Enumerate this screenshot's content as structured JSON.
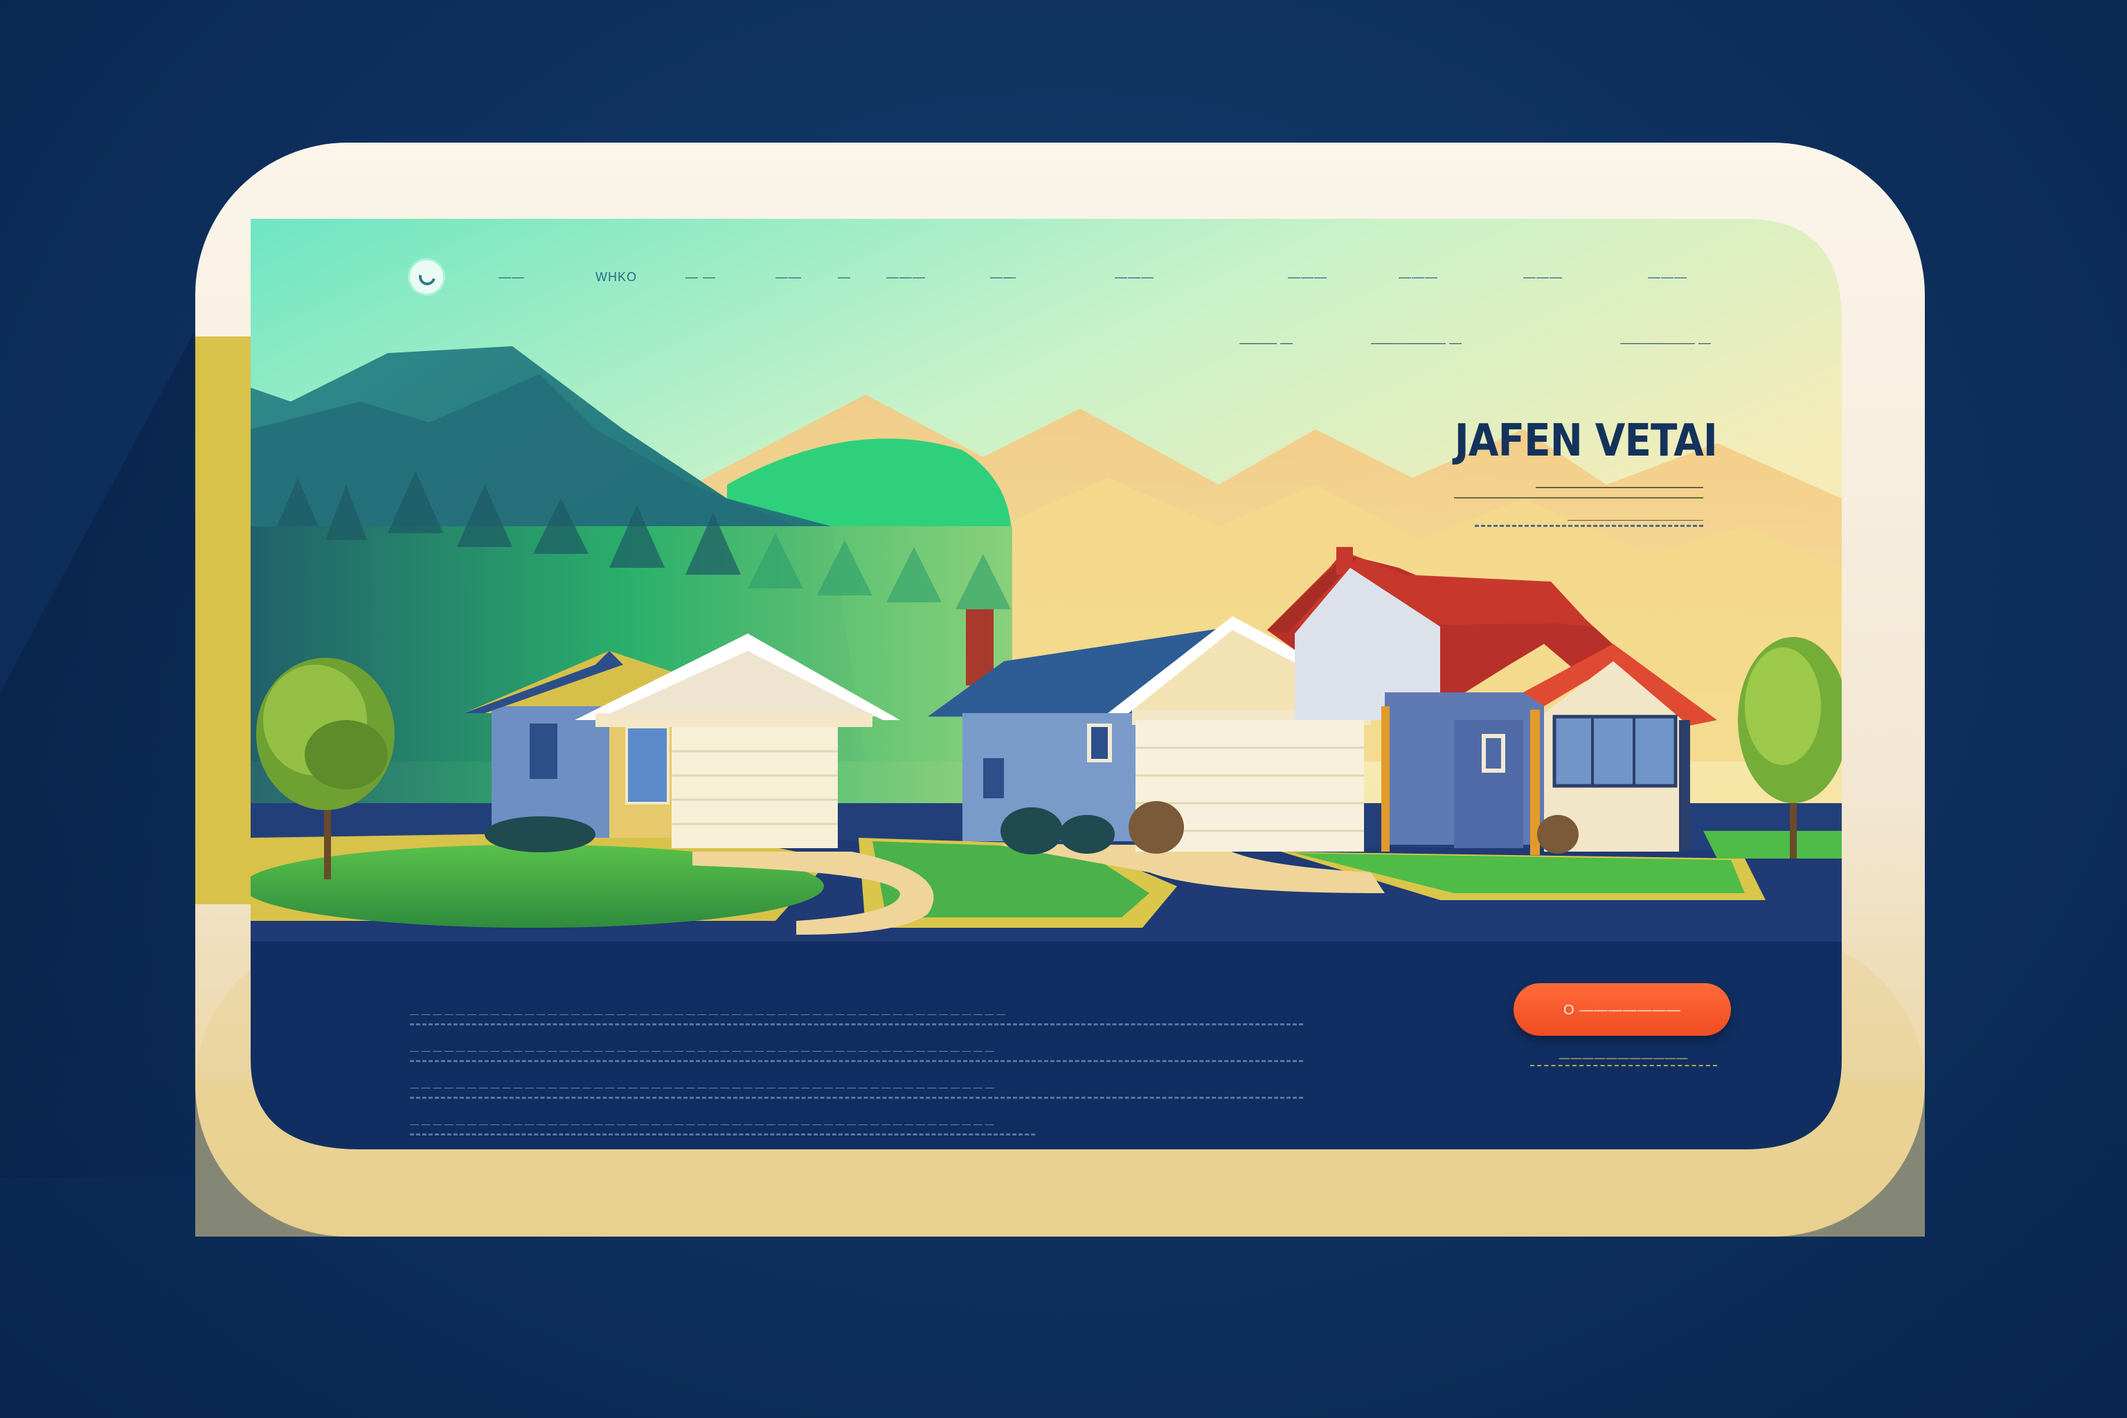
{
  "site": {
    "nav": {
      "items": [
        {
          "label": "WHKO"
        },
        {
          "label": "——"
        },
        {
          "label": "— —"
        },
        {
          "label": "——"
        },
        {
          "label": "—"
        },
        {
          "label": "———"
        },
        {
          "label": "——"
        },
        {
          "label": "———"
        },
        {
          "label": "———"
        },
        {
          "label": "———"
        },
        {
          "label": "———"
        },
        {
          "label": "———"
        }
      ],
      "sub_links": [
        {
          "label": "——— —"
        },
        {
          "label": "—————— —"
        },
        {
          "label": "—————— —"
        }
      ]
    },
    "hero": {
      "title": "JAFEN VETAI",
      "subtitle": "———————————",
      "caption": "——————————————"
    },
    "footer": {
      "body_lines": [
        "— — — — — — — — — — — — — — — — — — — — — — — — — — — — — — — — — — — — — — — — — — — — — — — — — — — —",
        "— — — — — — — — — — — — — — — — — — — — — — — — — — — — — — — — — — — — — — — — — — — — — — — — — — —",
        "— — — — — — — — — — — — — — — — — — — — — — — — — — — — — — — — — — — — — — — — — — — — — — — — — — —",
        "— — — — — — — — — — — — — — — — — — — — — — — — — — — — — — — — — — — — — — — — — — — — — — — — — — —"
      ],
      "cta_label": "O ———————",
      "cta_caption": "———————————"
    },
    "colors": {
      "background": "#0f3361",
      "frame": "#f6efe2",
      "footer_panel": "#102e61",
      "cta": "#f2552a",
      "title": "#14335c"
    },
    "icons": {
      "logo": "circle-logo-icon"
    }
  }
}
